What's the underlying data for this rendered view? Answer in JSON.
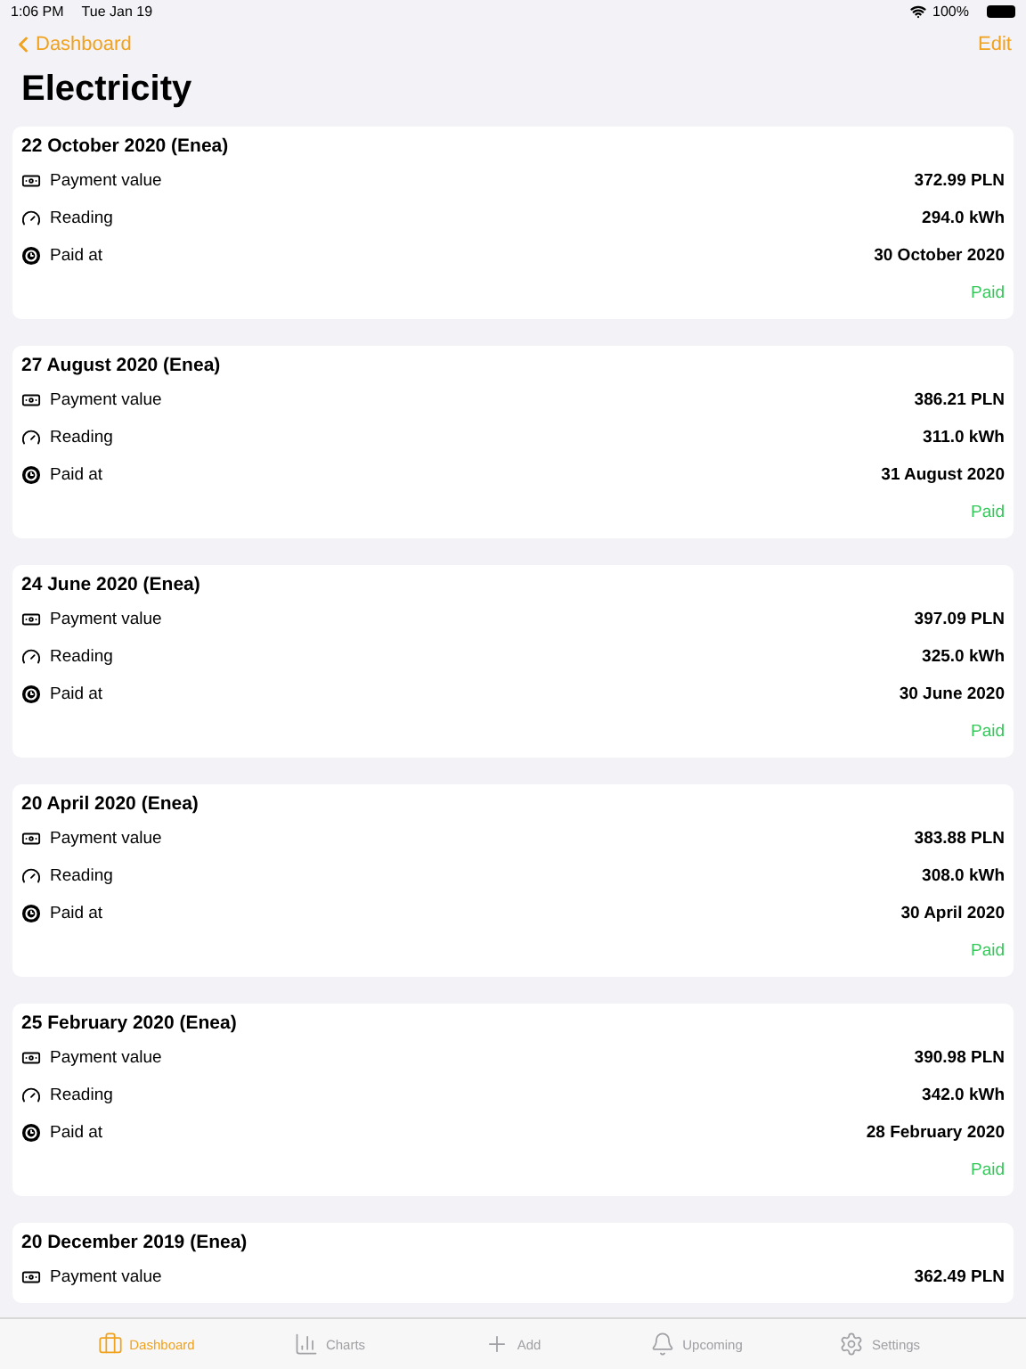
{
  "status_bar": {
    "time": "1:06 PM",
    "date": "Tue Jan 19",
    "battery": "100%"
  },
  "nav": {
    "back": "Dashboard",
    "action": "Edit"
  },
  "title": "Electricity",
  "cards": [
    {
      "title": "22 October 2020 (Enea)",
      "rows": [
        {
          "kind": "money",
          "label": "Payment value",
          "value": "372.99 PLN"
        },
        {
          "kind": "gauge",
          "label": "Reading",
          "value": "294.0 kWh"
        },
        {
          "kind": "clock",
          "label": "Paid at",
          "value": "30 October 2020"
        }
      ],
      "status": "Paid"
    },
    {
      "title": "27 August 2020 (Enea)",
      "rows": [
        {
          "kind": "money",
          "label": "Payment value",
          "value": "386.21 PLN"
        },
        {
          "kind": "gauge",
          "label": "Reading",
          "value": "311.0 kWh"
        },
        {
          "kind": "clock",
          "label": "Paid at",
          "value": "31 August 2020"
        }
      ],
      "status": "Paid"
    },
    {
      "title": "24 June 2020 (Enea)",
      "rows": [
        {
          "kind": "money",
          "label": "Payment value",
          "value": "397.09 PLN"
        },
        {
          "kind": "gauge",
          "label": "Reading",
          "value": "325.0 kWh"
        },
        {
          "kind": "clock",
          "label": "Paid at",
          "value": "30 June 2020"
        }
      ],
      "status": "Paid"
    },
    {
      "title": "20 April 2020 (Enea)",
      "rows": [
        {
          "kind": "money",
          "label": "Payment value",
          "value": "383.88 PLN"
        },
        {
          "kind": "gauge",
          "label": "Reading",
          "value": "308.0 kWh"
        },
        {
          "kind": "clock",
          "label": "Paid at",
          "value": "30 April 2020"
        }
      ],
      "status": "Paid"
    },
    {
      "title": "25 February 2020 (Enea)",
      "rows": [
        {
          "kind": "money",
          "label": "Payment value",
          "value": "390.98 PLN"
        },
        {
          "kind": "gauge",
          "label": "Reading",
          "value": "342.0 kWh"
        },
        {
          "kind": "clock",
          "label": "Paid at",
          "value": "28 February 2020"
        }
      ],
      "status": "Paid"
    },
    {
      "title": "20 December 2019 (Enea)",
      "rows": [
        {
          "kind": "money",
          "label": "Payment value",
          "value": "362.49 PLN"
        }
      ]
    }
  ],
  "tabs": [
    {
      "kind": "briefcase",
      "label": "Dashboard",
      "selected": true
    },
    {
      "kind": "chart",
      "label": "Charts",
      "selected": false
    },
    {
      "kind": "plus",
      "label": "Add",
      "selected": false
    },
    {
      "kind": "bell",
      "label": "Upcoming",
      "selected": false
    },
    {
      "kind": "gear",
      "label": "Settings",
      "selected": false
    }
  ]
}
